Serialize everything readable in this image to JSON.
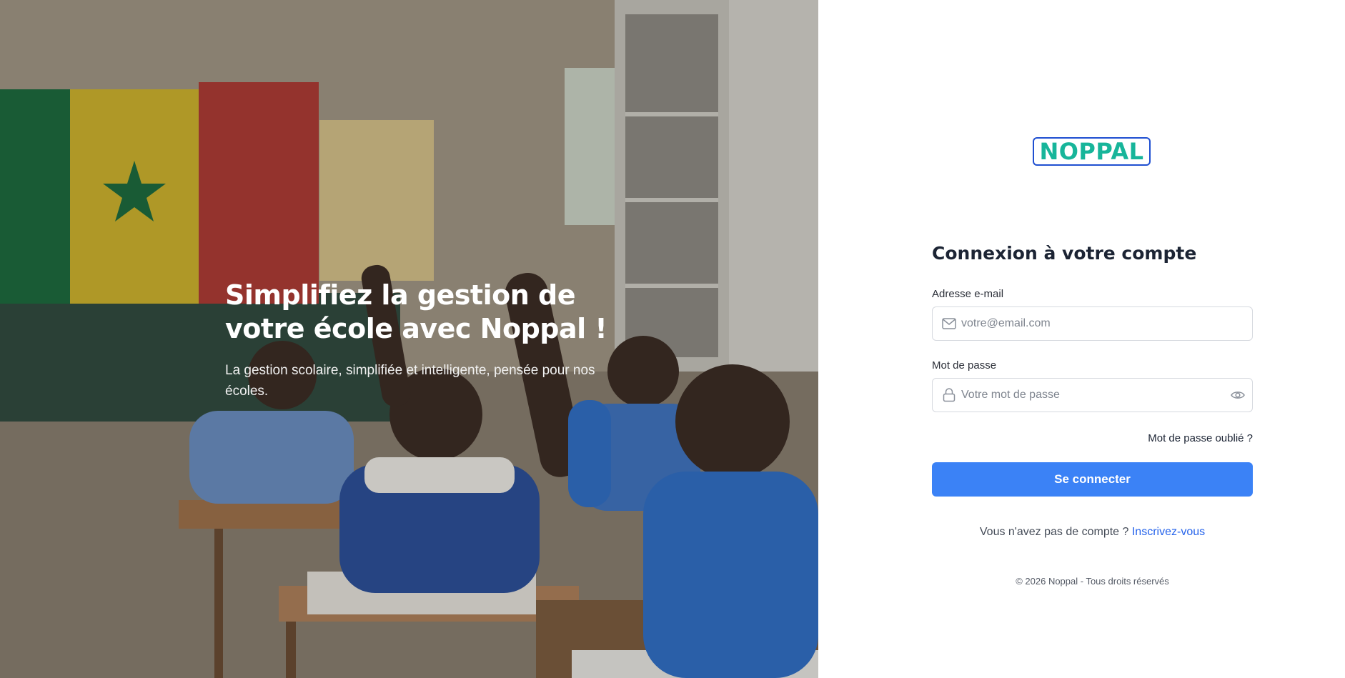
{
  "hero": {
    "title_line1": "Simplifiez la gestion de",
    "title_line2": "votre école avec Noppal !",
    "subtitle": "La gestion scolaire, simplifiée et intelligente, pensée pour nos écoles."
  },
  "brand": {
    "logo_text": "NOPPAL"
  },
  "login": {
    "title": "Connexion à votre compte",
    "email_label": "Adresse e-mail",
    "email_placeholder": "votre@email.com",
    "password_label": "Mot de passe",
    "password_placeholder": "Votre mot de passe",
    "forgot_label": "Mot de passe oublié ?",
    "submit_label": "Se connecter",
    "signup_prompt": "Vous n'avez pas de compte ?",
    "signup_link": "Inscrivez-vous"
  },
  "footer": {
    "copyright": "© 2026 Noppal - Tous droits réservés"
  },
  "colors": {
    "accent": "#3b82f6",
    "link": "#2563eb",
    "logo_border": "#1f4fd1",
    "logo_text": "#17b59a"
  }
}
